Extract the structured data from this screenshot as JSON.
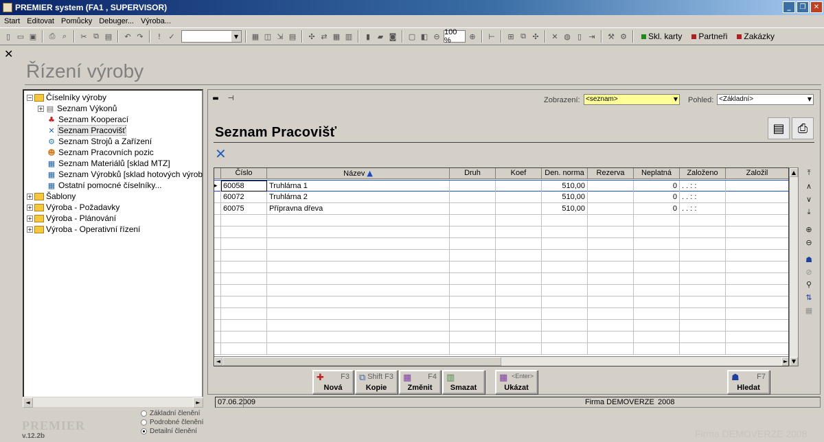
{
  "window": {
    "title": "PREMIER system (FA1 , SUPERVISOR)"
  },
  "menu": [
    "Start",
    "Editovat",
    "Pomůcky",
    "Debuger...",
    "Výroba..."
  ],
  "toolbar": {
    "zoom": "100 %",
    "links": [
      {
        "label": "Skl. karty",
        "color": "#1a8a1a"
      },
      {
        "label": "Partneři",
        "color": "#b02020"
      },
      {
        "label": "Zakázky",
        "color": "#b02020"
      }
    ]
  },
  "page": {
    "title": "Řízení výroby"
  },
  "tree": {
    "items": [
      {
        "label": "Číselníky výroby",
        "level": 0,
        "expander": "−",
        "icon": "folder-open-icon"
      },
      {
        "label": "Seznam Výkonů",
        "level": 1,
        "expander": "+",
        "icon": "list-icon"
      },
      {
        "label": "Seznam Kooperací",
        "level": 1,
        "expander": "",
        "icon": "people-icon"
      },
      {
        "label": "Seznam Pracovišť",
        "level": 1,
        "expander": "",
        "icon": "tools-icon"
      },
      {
        "label": "Seznam Strojů a Zařízení",
        "level": 1,
        "expander": "",
        "icon": "gear-icon"
      },
      {
        "label": "Seznam Pracovních pozic",
        "level": 1,
        "expander": "",
        "icon": "person-icon"
      },
      {
        "label": "Seznam Materiálů [sklad MTZ]",
        "level": 1,
        "expander": "",
        "icon": "table-icon"
      },
      {
        "label": "Seznam Výrobků [sklad hotových výrob",
        "level": 1,
        "expander": "",
        "icon": "table-icon"
      },
      {
        "label": "Ostatní pomocné číselníky...",
        "level": 1,
        "expander": "",
        "icon": "table-icon"
      },
      {
        "label": "Šablony",
        "level": 0,
        "expander": "+",
        "icon": "folder-icon"
      },
      {
        "label": "Výroba - Požadavky",
        "level": 0,
        "expander": "+",
        "icon": "folder-icon"
      },
      {
        "label": "Výroba - Plánování",
        "level": 0,
        "expander": "+",
        "icon": "folder-icon"
      },
      {
        "label": "Výroba - Operativní řízení",
        "level": 0,
        "expander": "+",
        "icon": "folder-icon"
      }
    ]
  },
  "panel": {
    "title": "Seznam Pracovišť",
    "view_label": "Zobrazení:",
    "view_value": "<seznam>",
    "perspective_label": "Pohled:",
    "perspective_value": "<Základní>"
  },
  "grid": {
    "columns": [
      "Číslo",
      "Název",
      "Druh",
      "Koef",
      "Den. norma",
      "Rezerva",
      "Neplatná",
      "Založeno",
      "Založil"
    ],
    "sort_column": "Název",
    "rows": [
      [
        "60058",
        "Truhlárna 1",
        "",
        "",
        "510,00",
        "",
        "0",
        ". .    : :",
        ""
      ],
      [
        "60072",
        "Truhlárna 2",
        "",
        "",
        "510,00",
        "",
        "0",
        ". .    : :",
        ""
      ],
      [
        "60075",
        "Přípravna dřeva",
        "",
        "",
        "510,00",
        "",
        "0",
        ". .    : :",
        ""
      ]
    ]
  },
  "actions": [
    {
      "name": "Nová",
      "key": "F3"
    },
    {
      "name": "Kopie",
      "key": "Shift F3"
    },
    {
      "name": "Změnit",
      "key": "F4"
    },
    {
      "name": "Smazat",
      "key": ""
    },
    {
      "name": "Ukázat",
      "key": "<Enter>"
    },
    {
      "name": "Hledat",
      "key": "F7"
    }
  ],
  "status": {
    "date": "07.06.2009",
    "company": "Firma DEMOVERZE",
    "year": "2008"
  },
  "tree_mode": {
    "options": [
      "Základní členění",
      "Podrobné členění",
      "Detailní členění"
    ],
    "selected": "Detailní členění"
  },
  "footer": {
    "logo": "PREMIER",
    "version": "v.12.2b",
    "watermark": "Firma DEMOVERZE    2008"
  }
}
